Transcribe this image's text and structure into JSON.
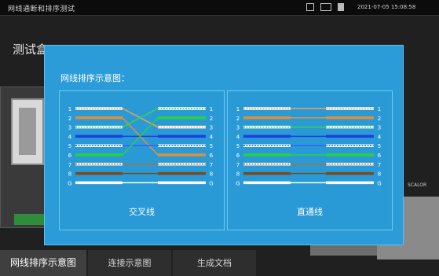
{
  "status_bar": {
    "title": "网线通断和排序测试",
    "datetime": "2021-07-05 15:08:58"
  },
  "background": {
    "page_title": "测试盒",
    "side_label": "SCALOR"
  },
  "tabs": [
    {
      "label": "网线排序示意图",
      "active": true
    },
    {
      "label": "连接示意图",
      "active": false
    },
    {
      "label": "生成文档",
      "active": false
    }
  ],
  "modal": {
    "title": "网线排序示意图：",
    "crossover": {
      "label": "交叉线",
      "pins_left": [
        "1",
        "2",
        "3",
        "4",
        "5",
        "6",
        "7",
        "8",
        "G"
      ],
      "pins_right": [
        "1",
        "2",
        "3",
        "4",
        "5",
        "6",
        "7",
        "8",
        "G"
      ],
      "mapping": [
        3,
        6,
        1,
        4,
        5,
        2,
        7,
        8,
        9
      ]
    },
    "straight": {
      "label": "直通线",
      "pins_left": [
        "1",
        "2",
        "3",
        "4",
        "5",
        "6",
        "7",
        "8",
        "G"
      ],
      "pins_right": [
        "1",
        "2",
        "3",
        "4",
        "5",
        "6",
        "7",
        "8",
        "G"
      ],
      "mapping": [
        1,
        2,
        3,
        4,
        5,
        6,
        7,
        8,
        9
      ]
    },
    "wire_colors": [
      {
        "base": "#ffffff",
        "stripe": "#f0a050"
      },
      {
        "base": "#e0903a",
        "stripe": "#e0903a"
      },
      {
        "base": "#ffffff",
        "stripe": "#3ad24a"
      },
      {
        "base": "#1e3fdc",
        "stripe": "#1e3fdc"
      },
      {
        "base": "#ffffff",
        "stripe": "#3060ff"
      },
      {
        "base": "#29d13f",
        "stripe": "#29d13f"
      },
      {
        "base": "#ffffff",
        "stripe": "#b07030"
      },
      {
        "base": "#7a4a1c",
        "stripe": "#7a4a1c"
      },
      {
        "base": "#ffffff",
        "stripe": "#ffffff"
      }
    ]
  }
}
